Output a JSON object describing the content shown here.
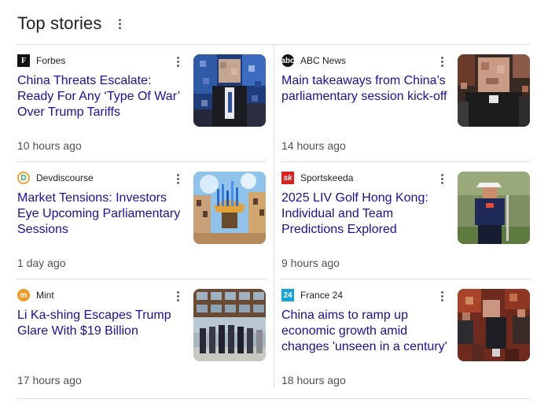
{
  "section": {
    "title": "Top stories"
  },
  "stories": [
    {
      "source": "Forbes",
      "logo_glyph": "F",
      "headline": "China Threats Escalate: Ready For Any ‘Type Of War’ Over Trump Tariffs",
      "time": "10 hours ago",
      "image": "pixelated-portrait"
    },
    {
      "source": "ABC News",
      "logo_glyph": "abc",
      "headline": "Main takeaways from China’s parliamentary session kick-off",
      "time": "14 hours ago",
      "image": "pixelated-portrait"
    },
    {
      "source": "Devdiscourse",
      "logo_glyph": "D",
      "headline": "Market Tensions: Investors Eye Upcoming Parliamentary Sessions",
      "time": "1 day ago",
      "image": "market-street-illustration"
    },
    {
      "source": "Sportskeeda",
      "logo_glyph": "sk",
      "headline": "2025 LIV Golf Hong Kong: Individual and Team Predictions Explored",
      "time": "9 hours ago",
      "image": "golfer-photo"
    },
    {
      "source": "Mint",
      "logo_glyph": "m",
      "headline": "Li Ka-shing Escapes Trump Glare With $19 Billion",
      "time": "17 hours ago",
      "image": "group-photo-building"
    },
    {
      "source": "France 24",
      "logo_glyph": "24",
      "headline": "China aims to ramp up economic growth amid changes 'unseen in a century'",
      "time": "18 hours ago",
      "image": "pixelated-crowd"
    }
  ],
  "colors": {
    "headline": "#1a0dab",
    "meta": "#4d5156",
    "divider": "#dadce0"
  }
}
